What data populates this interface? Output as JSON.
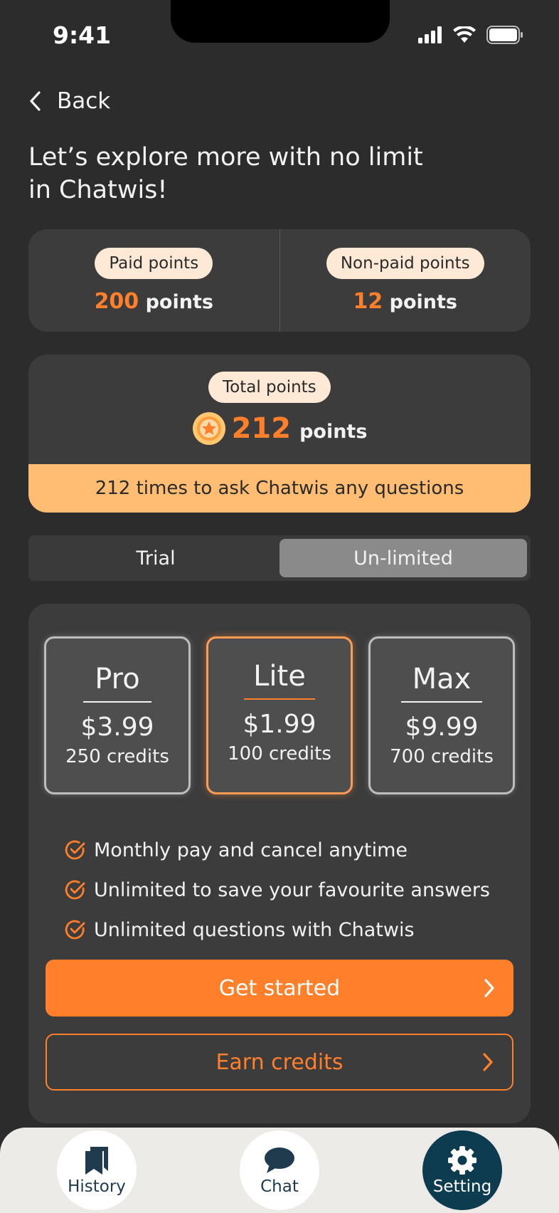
{
  "status_bar": {
    "time": "9:41"
  },
  "header": {
    "back_label": "Back",
    "headline_line1": "Let’s explore more with no limit",
    "headline_line2": "in Chatwis!"
  },
  "points": {
    "paid_label": "Paid points",
    "paid_value": "200",
    "non_paid_label": "Non-paid points",
    "non_paid_value": "12",
    "unit": "points"
  },
  "total": {
    "label": "Total points",
    "value": "212",
    "unit": "points",
    "banner": "212 times to ask Chatwis any questions"
  },
  "segment": {
    "options": [
      "Trial",
      "Un-limited"
    ],
    "selected": "Un-limited"
  },
  "plans": [
    {
      "name": "Pro",
      "price": "$3.99",
      "credits": "250 credits"
    },
    {
      "name": "Lite",
      "price": "$1.99",
      "credits": "100 credits"
    },
    {
      "name": "Max",
      "price": "$9.99",
      "credits": "700 credits"
    }
  ],
  "selected_plan": "Lite",
  "features": [
    "Monthly pay and cancel anytime",
    "Unlimited to save your favourite answers",
    "Unlimited questions with Chatwis"
  ],
  "buttons": {
    "primary": "Get started",
    "secondary": "Earn credits"
  },
  "tabs": [
    {
      "label": "History",
      "icon": "bookmarks-icon"
    },
    {
      "label": "Chat",
      "icon": "chat-bubble-icon"
    },
    {
      "label": "Setting",
      "icon": "gear-icon"
    }
  ],
  "active_tab": "Setting",
  "colors": {
    "accent": "#ff7f2a",
    "banner": "#ffbd73",
    "pill": "#fde9d6",
    "active_tab": "#0d3b4f"
  }
}
